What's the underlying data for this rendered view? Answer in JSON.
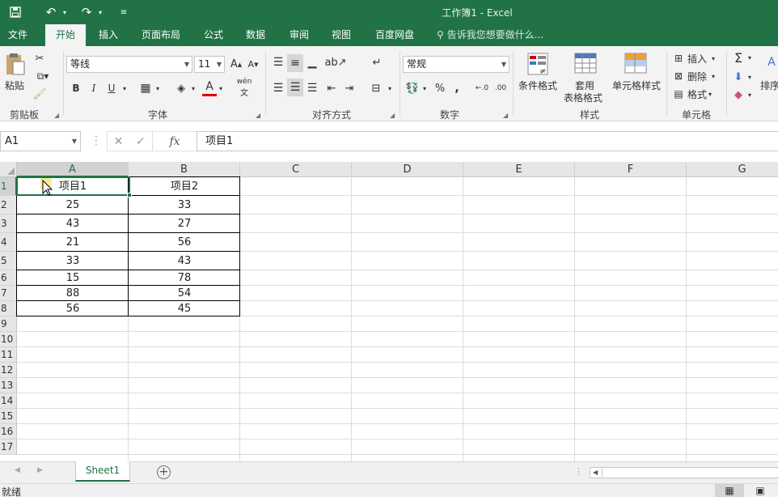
{
  "window": {
    "title": "工作簿1 - Excel"
  },
  "qat": {
    "save_icon": "save-icon",
    "undo_icon": "undo-icon",
    "redo_icon": "redo-icon",
    "customize_icon": "customize-icon"
  },
  "tabs": [
    {
      "label": "文件"
    },
    {
      "label": "开始"
    },
    {
      "label": "插入"
    },
    {
      "label": "页面布局"
    },
    {
      "label": "公式"
    },
    {
      "label": "数据"
    },
    {
      "label": "审阅"
    },
    {
      "label": "视图"
    },
    {
      "label": "百度网盘"
    }
  ],
  "tell_me": "告诉我您想要做什么...",
  "ribbon": {
    "clipboard": {
      "label": "剪贴板",
      "paste": "粘贴"
    },
    "font": {
      "label": "字体",
      "name": "等线",
      "size": "11",
      "bold": "B",
      "italic": "I",
      "underline": "U",
      "grow": "A",
      "shrink": "A",
      "color": "A",
      "phonetic": "wén"
    },
    "alignment": {
      "label": "对齐方式"
    },
    "number": {
      "label": "数字",
      "format": "常规",
      "percent": "%",
      "comma": ","
    },
    "styles": {
      "label": "样式",
      "conditional": "条件格式",
      "table_line1": "套用",
      "table_line2": "表格格式",
      "cell_styles": "单元格样式"
    },
    "cells": {
      "label": "单元格",
      "insert": "插入",
      "delete": "删除",
      "format": "格式"
    },
    "editing": {
      "sort": "排序",
      "sum": "Σ"
    }
  },
  "formula_bar": {
    "name_box": "A1",
    "fx": "fx",
    "value": "项目1"
  },
  "columns": [
    "A",
    "B",
    "C",
    "D",
    "E",
    "F",
    "G"
  ],
  "rows": [
    "1",
    "2",
    "3",
    "4",
    "5",
    "6",
    "7",
    "8",
    "9",
    "10",
    "11",
    "12",
    "13",
    "14",
    "15",
    "16",
    "17"
  ],
  "table": {
    "headers": [
      "项目1",
      "项目2"
    ],
    "data": [
      [
        "25",
        "33"
      ],
      [
        "43",
        "27"
      ],
      [
        "21",
        "56"
      ],
      [
        "33",
        "43"
      ],
      [
        "15",
        "78"
      ],
      [
        "88",
        "54"
      ],
      [
        "56",
        "45"
      ]
    ]
  },
  "sheets": [
    {
      "name": "Sheet1"
    }
  ],
  "status": {
    "ready": "就绪"
  }
}
